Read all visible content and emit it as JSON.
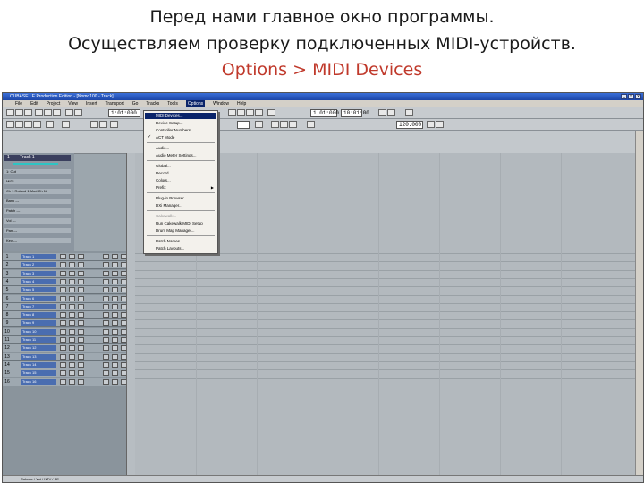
{
  "caption": {
    "line1": "Перед нами главное окно программы.",
    "line2": "Осуществляем проверку подключенных MIDI-устройств.",
    "line3": "Options > MIDI Devices"
  },
  "window": {
    "title": "CUBASE LE Production Edition - [Nomo100 - Track]",
    "min": "_",
    "max": "□",
    "close": "x"
  },
  "menubar": [
    "File",
    "Edit",
    "Project",
    "View",
    "Insert",
    "Transport",
    "Go",
    "Tracks",
    "Tools",
    "Options",
    "Window",
    "Help"
  ],
  "menubar_active": "Options",
  "toolbar": {
    "time1": "1:01:000",
    "time2": "1:01:000",
    "time3": "1:01:000",
    "tempo": "120.000",
    "bpm_value": "10:01:00"
  },
  "options_menu": {
    "items": [
      {
        "label": "MIDI Devices...",
        "state": "selected"
      },
      {
        "label": "Device Setup...",
        "state": "normal"
      },
      {
        "label": "Controller Numbers...",
        "state": "normal"
      },
      {
        "label": "ACT Mode",
        "state": "checked"
      },
      {
        "label": "Audio...",
        "state": "normal"
      },
      {
        "label": "Audio Meter Settings...",
        "state": "normal"
      },
      {
        "label": "Global...",
        "state": "normal"
      },
      {
        "label": "Record...",
        "state": "normal"
      },
      {
        "label": "Colors...",
        "state": "normal"
      },
      {
        "label": "Prefix",
        "state": "submenu"
      },
      {
        "label": "Plug-in Browser...",
        "state": "normal"
      },
      {
        "label": "DXi Manager...",
        "state": "normal"
      },
      {
        "label": "Cakewalk...",
        "state": "disabled"
      },
      {
        "label": "Run Cakewalk MIDI Setup",
        "state": "normal"
      },
      {
        "label": "Drum Map Manager...",
        "state": "normal"
      },
      {
        "label": "Patch Names...",
        "state": "normal"
      },
      {
        "label": "Patch Layouts...",
        "state": "normal"
      }
    ],
    "checkmark": "✓",
    "submenu_arrow": "▶"
  },
  "inspector": {
    "header": "1",
    "track_name": "Track 1",
    "rows": [
      "1: Out",
      "MIDI",
      "Ch 1 Roland 1 Mod Ch 16",
      "Bank ---",
      "Patch ---",
      "Vol ---",
      "Pan ---",
      "Key ---"
    ]
  },
  "tracks": [
    {
      "num": "1",
      "name": "Track 1"
    },
    {
      "num": "2",
      "name": "Track 2"
    },
    {
      "num": "3",
      "name": "Track 3"
    },
    {
      "num": "4",
      "name": "Track 4"
    },
    {
      "num": "5",
      "name": "Track 5"
    },
    {
      "num": "6",
      "name": "Track 6"
    },
    {
      "num": "7",
      "name": "Track 7"
    },
    {
      "num": "8",
      "name": "Track 8"
    },
    {
      "num": "9",
      "name": "Track 9"
    },
    {
      "num": "10",
      "name": "Track 10"
    },
    {
      "num": "11",
      "name": "Track 11"
    },
    {
      "num": "12",
      "name": "Track 12"
    },
    {
      "num": "13",
      "name": "Track 13"
    },
    {
      "num": "14",
      "name": "Track 14"
    },
    {
      "num": "15",
      "name": "Track 15"
    },
    {
      "num": "16",
      "name": "Track 16"
    }
  ],
  "status": "Cubase / Vst / NTV / SE"
}
